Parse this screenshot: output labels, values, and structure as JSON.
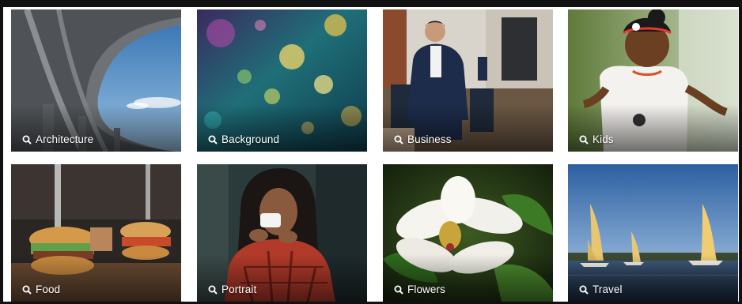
{
  "gallery": {
    "tiles": [
      {
        "label": "Architecture",
        "icon": "search-icon"
      },
      {
        "label": "Background",
        "icon": "search-icon"
      },
      {
        "label": "Business",
        "icon": "search-icon"
      },
      {
        "label": "Kids",
        "icon": "search-icon"
      },
      {
        "label": "Food",
        "icon": "search-icon"
      },
      {
        "label": "Portrait",
        "icon": "search-icon"
      },
      {
        "label": "Flowers",
        "icon": "search-icon"
      },
      {
        "label": "Travel",
        "icon": "search-icon"
      }
    ]
  }
}
